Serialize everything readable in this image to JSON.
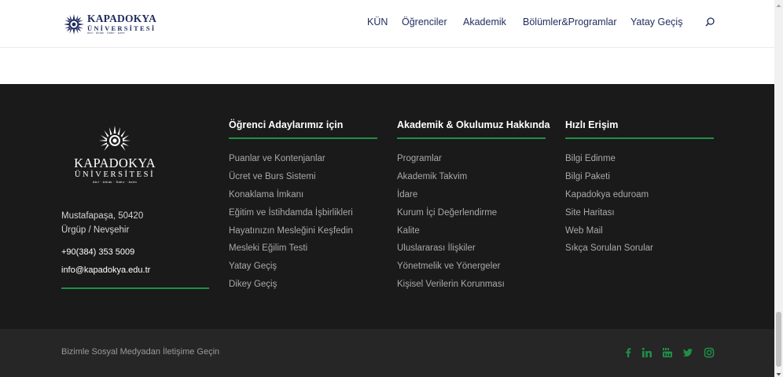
{
  "header": {
    "logo": {
      "line1": "KAPADOKYA",
      "line2": "ÜNİVERSİTESİ",
      "line3": "Akıl · Ahlak · Sabır · Azim"
    },
    "nav": [
      "KÜN",
      "Öğrenciler",
      "Akademik",
      "Bölümler&Programlar",
      "Yatay Geçiş"
    ]
  },
  "footer": {
    "logo": {
      "line1": "KAPADOKYA",
      "line2": "ÜNİVERSİTESİ",
      "line3": "Akıl · Ahlak · Sabır · Azim"
    },
    "address_line1": "Mustafapaşa, 50420",
    "address_line2": "Ürgüp / Nevşehir",
    "phone": "+90(384) 353 5009",
    "email": "info@kapadokya.edu.tr",
    "columns": [
      {
        "title": "Öğrenci Adaylarımız için",
        "links": [
          "Puanlar ve Kontenjanlar",
          "Ücret ve Burs Sistemi",
          "Konaklama İmkanı",
          "Eğitim ve İstihdamda İşbirlikleri",
          "Hayatınızın Mesleğini Keşfedin",
          "Mesleki Eğilim Testi",
          "Yatay Geçiş",
          "Dikey Geçiş"
        ]
      },
      {
        "title": "Akademik & Okulumuz Hakkında",
        "links": [
          "Programlar",
          "Akademik Takvim",
          "İdare",
          "Kurum İçi Değerlendirme",
          "Kalite",
          "Uluslararası İlişkiler",
          "Yönetmelik ve Yönergeler",
          "Kişisel Verilerin Korunması"
        ]
      },
      {
        "title": "Hızlı Erişim",
        "links": [
          "Bilgi Edinme",
          "Bilgi Paketi",
          "Kapadokya eduroam",
          "Site Haritası",
          "Web Mail",
          "Sıkça Sorulan Sorular"
        ]
      }
    ],
    "social_text": "Bizimle Sosyal Medyadan İletişime Geçin",
    "social_icons": [
      "facebook-icon",
      "linkedin-icon",
      "youtube-icon",
      "twitter-icon",
      "instagram-icon"
    ]
  },
  "colors": {
    "navy": "#1e2b5e",
    "footer_bg": "#1a1a1a",
    "footer_bottom_bg": "#262626",
    "accent_green": "#1f8f47"
  }
}
